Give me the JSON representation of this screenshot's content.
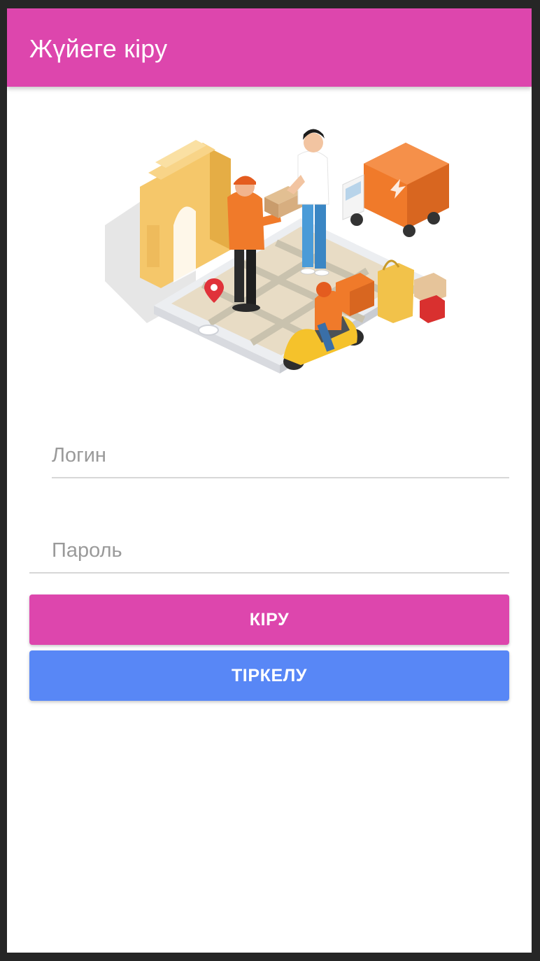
{
  "app_bar": {
    "title": "Жүйеге кіру"
  },
  "hero_image": {
    "icon": "delivery-illustration",
    "colors": {
      "accent_orange": "#f07a2a",
      "arch_yellow": "#f5c76a",
      "map_beige": "#e6dcc8",
      "phone_white": "#f3f4f6"
    }
  },
  "form": {
    "login_placeholder": "Логин",
    "login_value": "",
    "password_placeholder": "Пароль",
    "password_value": ""
  },
  "buttons": {
    "login_label": "КІРУ",
    "register_label": "ТІРКЕЛУ"
  },
  "colors": {
    "primary": "#dd46ad",
    "secondary": "#5887f6",
    "frame": "#262626"
  }
}
